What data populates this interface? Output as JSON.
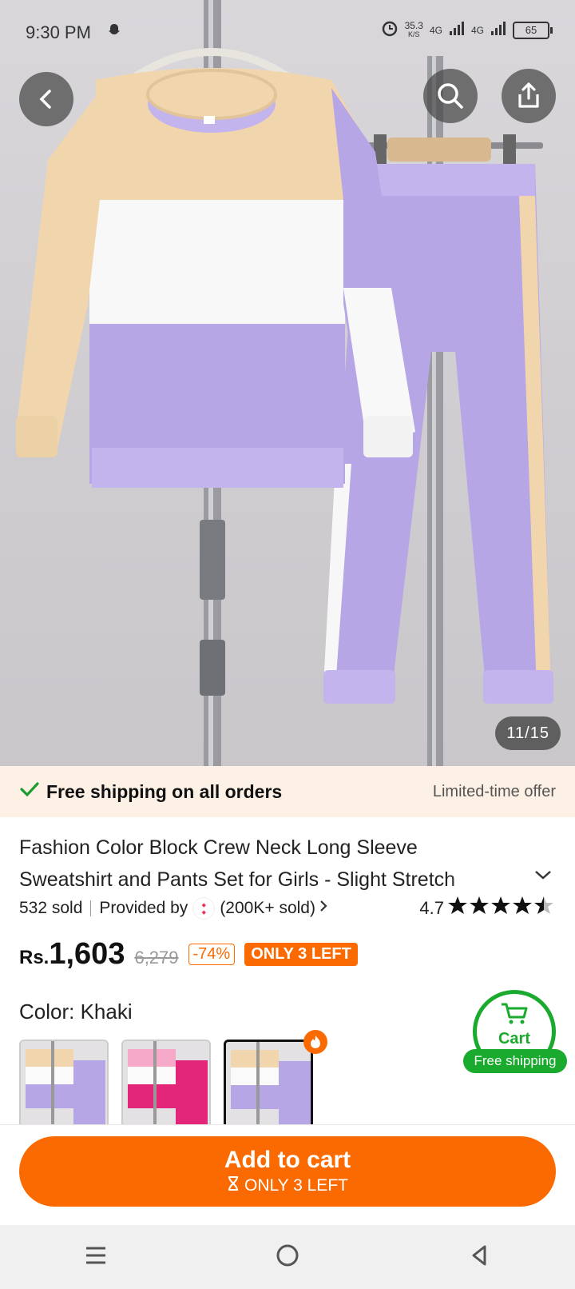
{
  "status_bar": {
    "time": "9:30 PM",
    "speed_value": "35.3",
    "speed_unit": "K/S",
    "network_1": "4G",
    "network_2": "4G",
    "battery": "65"
  },
  "gallery": {
    "counter": "11/15"
  },
  "shipping_bar": {
    "text": "Free shipping on all orders",
    "offer": "Limited-time offer"
  },
  "product": {
    "title_line1": "Fashion Color Block Crew Neck Long Sleeve",
    "title_line2": "Sweatshirt and Pants Set for Girls - Slight Stretch",
    "sold": "532 sold",
    "provided_by": "Provided by",
    "store_sold": "(200K+ sold)",
    "rating": "4.7",
    "currency": "Rs.",
    "price": "1,603",
    "old_price": "6,279",
    "discount": "-74%",
    "stock_badge": "ONLY 3 LEFT",
    "color_label": "Color: Khaki"
  },
  "cart_float": {
    "label": "Cart",
    "shipping": "Free shipping"
  },
  "cta": {
    "label": "Add to cart",
    "sub": "ONLY 3 LEFT"
  },
  "colors": {
    "accent": "#fa6a00",
    "green": "#1aaa2e",
    "lavender": "#b7a6e6",
    "khaki": "#f1d6ad"
  }
}
